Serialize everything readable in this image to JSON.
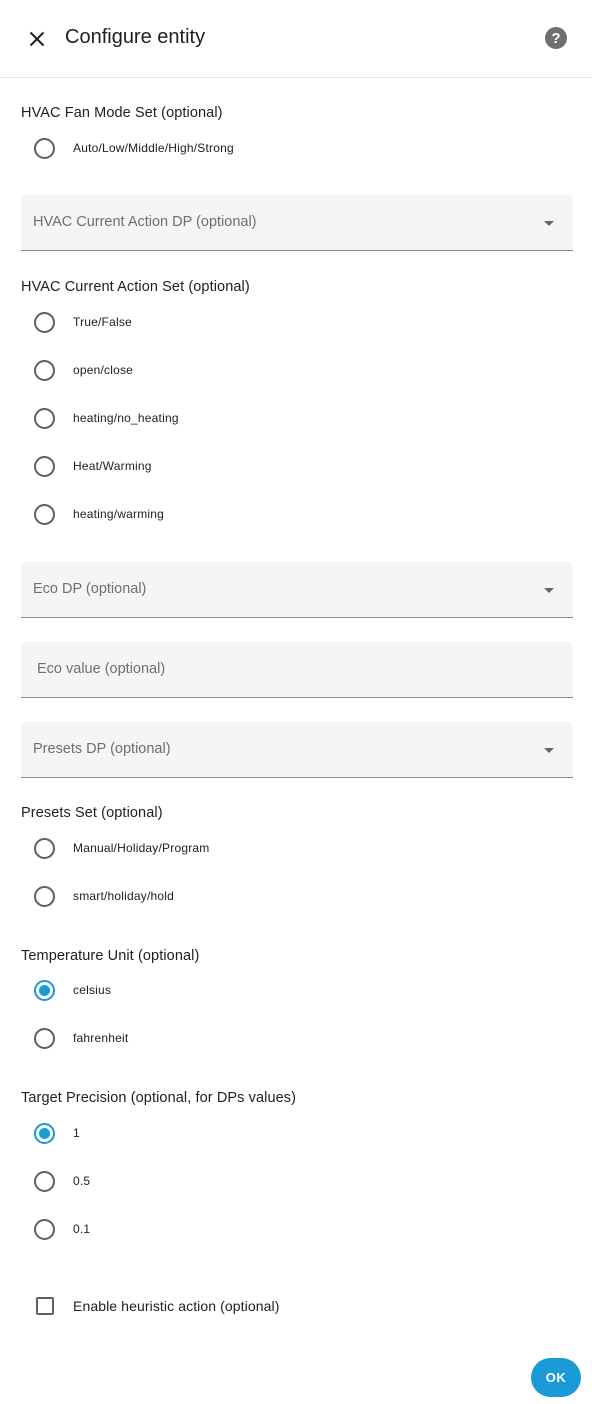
{
  "header": {
    "title": "Configure entity",
    "close_icon": "close-icon",
    "help_icon": "help-circle-icon",
    "help_glyph": "?"
  },
  "hvac_fan_mode_set": {
    "label": "HVAC Fan Mode Set (optional)",
    "options": [
      {
        "label": "Auto/Low/Middle/High/Strong",
        "checked": false
      }
    ]
  },
  "hvac_current_action_dp": {
    "label": "HVAC Current Action DP (optional)"
  },
  "hvac_current_action_set": {
    "label": "HVAC Current Action Set (optional)",
    "options": [
      {
        "label": "True/False",
        "checked": false
      },
      {
        "label": "open/close",
        "checked": false
      },
      {
        "label": "heating/no_heating",
        "checked": false
      },
      {
        "label": "Heat/Warming",
        "checked": false
      },
      {
        "label": "heating/warming",
        "checked": false
      }
    ]
  },
  "eco_dp": {
    "label": "Eco DP (optional)"
  },
  "eco_value": {
    "label": "Eco value (optional)"
  },
  "presets_dp": {
    "label": "Presets DP (optional)"
  },
  "presets_set": {
    "label": "Presets Set (optional)",
    "options": [
      {
        "label": "Manual/Holiday/Program",
        "checked": false
      },
      {
        "label": "smart/holiday/hold",
        "checked": false
      }
    ]
  },
  "temperature_unit": {
    "label": "Temperature Unit (optional)",
    "options": [
      {
        "label": "celsius",
        "checked": true
      },
      {
        "label": "fahrenheit",
        "checked": false
      }
    ]
  },
  "target_precision": {
    "label": "Target Precision (optional, for DPs values)",
    "options": [
      {
        "label": "1",
        "checked": true
      },
      {
        "label": "0.5",
        "checked": false
      },
      {
        "label": "0.1",
        "checked": false
      }
    ]
  },
  "heuristic_action": {
    "label": "Enable heuristic action (optional)",
    "checked": false
  },
  "footer": {
    "ok_label": "OK"
  },
  "colors": {
    "accent": "#1a9bd7",
    "field_bg": "#f5f5f5",
    "text": "#212121",
    "muted": "#6f6f6f"
  }
}
